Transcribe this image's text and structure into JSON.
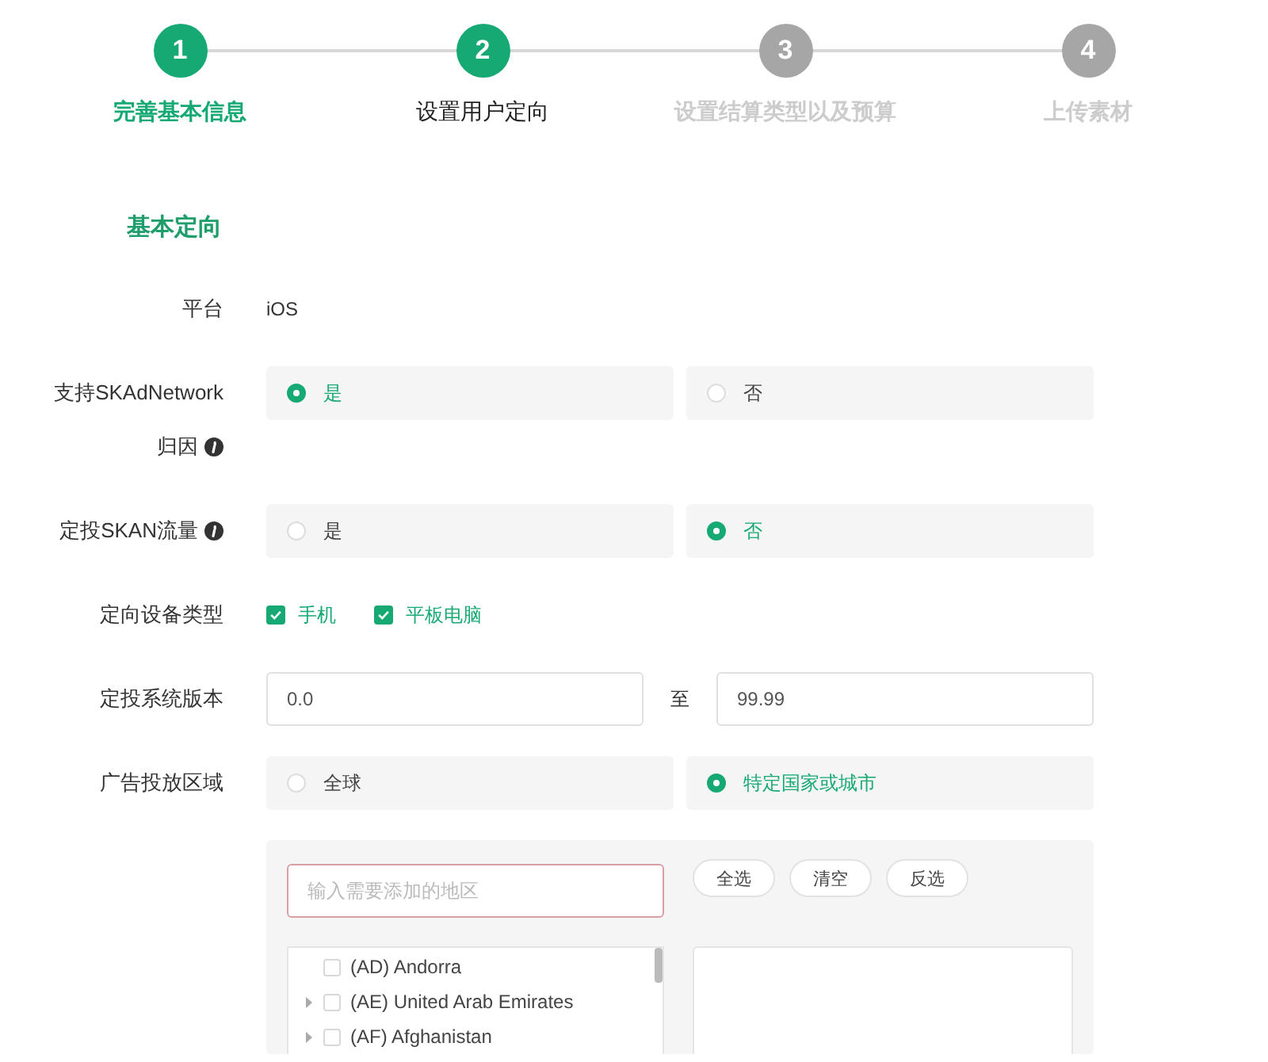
{
  "steps": [
    {
      "number": "1",
      "label": "完善基本信息",
      "completed": true,
      "selected": false
    },
    {
      "number": "2",
      "label": "设置用户定向",
      "completed": false,
      "selected": true
    },
    {
      "number": "3",
      "label": "设置结算类型以及预算",
      "completed": false,
      "selected": false
    },
    {
      "number": "4",
      "label": "上传素材",
      "completed": false,
      "selected": false
    }
  ],
  "section_title": "基本定向",
  "rows": [
    {
      "kind": "text",
      "label_lines": [
        "平台"
      ],
      "has_info": false,
      "value": "iOS"
    },
    {
      "kind": "radio",
      "label_lines": [
        "支持SKAdNetwork",
        "归因"
      ],
      "has_info": true,
      "options": [
        {
          "label": "是",
          "selected": true
        },
        {
          "label": "否",
          "selected": false
        }
      ]
    },
    {
      "kind": "radio",
      "label_lines": [
        "定投SKAN流量"
      ],
      "has_info": true,
      "options": [
        {
          "label": "是",
          "selected": false
        },
        {
          "label": "否",
          "selected": true
        }
      ]
    },
    {
      "kind": "checkbox",
      "label_lines": [
        "定向设备类型"
      ],
      "has_info": false,
      "options": [
        {
          "label": "手机",
          "checked": true
        },
        {
          "label": "平板电脑",
          "checked": true
        }
      ]
    },
    {
      "kind": "range",
      "label_lines": [
        "定投系统版本"
      ],
      "has_info": false,
      "from": "0.0",
      "separator": "至",
      "to": "99.99"
    },
    {
      "kind": "radio",
      "label_lines": [
        "广告投放区域"
      ],
      "has_info": false,
      "options": [
        {
          "label": "全球",
          "selected": false
        },
        {
          "label": "特定国家或城市",
          "selected": true
        }
      ]
    }
  ],
  "region_panel": {
    "search_placeholder": "输入需要添加的地区",
    "buttons": [
      "全选",
      "清空",
      "反选"
    ],
    "regions": [
      {
        "label": "(AD) Andorra",
        "expandable": false,
        "checked": false
      },
      {
        "label": "(AE) United Arab Emirates",
        "expandable": true,
        "checked": false
      },
      {
        "label": "(AF) Afghanistan",
        "expandable": true,
        "checked": false
      }
    ]
  }
}
